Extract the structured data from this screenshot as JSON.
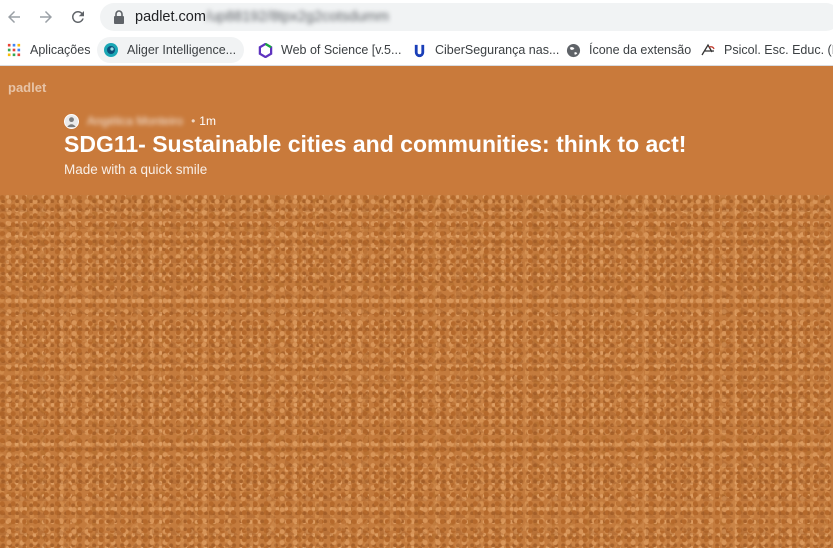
{
  "browser": {
    "url_host": "padlet.com",
    "url_path": "/up88192/8tpx2g2cotsdumm",
    "bookmarks": [
      {
        "label": "Aplicações",
        "icon": "apps-grid-icon"
      },
      {
        "label": "Aliger Intelligence...",
        "icon": "aliger-icon"
      },
      {
        "label": "Web of Science [v.5...",
        "icon": "web-of-science-icon"
      },
      {
        "label": "CiberSegurança nas...",
        "icon": "ciberseguranca-icon"
      },
      {
        "label": "Ícone da extensão",
        "icon": "globe-icon"
      },
      {
        "label": "Psicol. Esc. Educ. (I...",
        "icon": "psicol-icon"
      }
    ]
  },
  "padlet": {
    "brand": "padlet",
    "author_name": "Angélica Monteiro",
    "separator": "•",
    "timestamp": "1m",
    "title": "SDG11- Sustainable cities and communities: think to act!",
    "subtitle": "Made with a quick smile"
  },
  "colors": {
    "header_bg": "#c97a3b",
    "board_bg": "#c47b3d",
    "title": "#ffffff"
  }
}
